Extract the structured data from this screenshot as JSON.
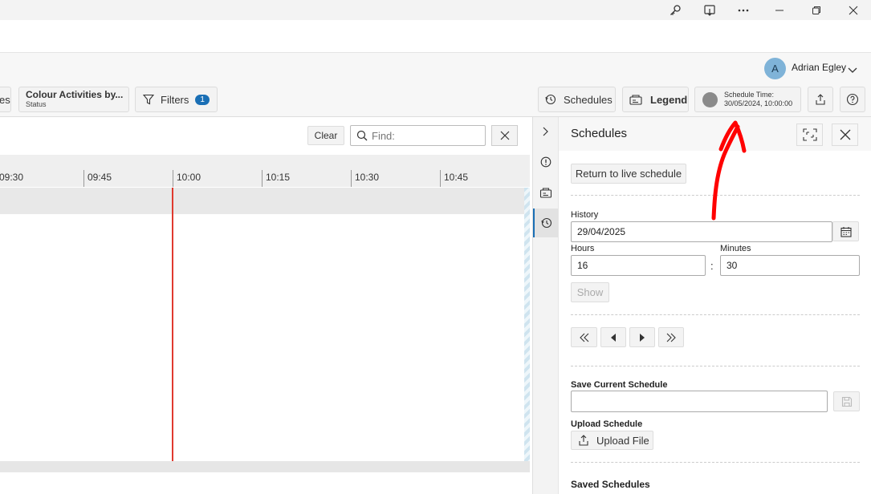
{
  "window": {
    "title_icons": [
      "key-icon",
      "reader-icon",
      "more-icon",
      "minimize-icon",
      "restore-icon",
      "close-icon"
    ]
  },
  "user": {
    "initial": "A",
    "name": "Adrian Egley"
  },
  "toolbar": {
    "truncated_left": "es",
    "colour_title": "Colour Activities by...",
    "colour_sub": "Status",
    "filters_label": "Filters",
    "filters_count": "1",
    "schedules_label": "Schedules",
    "legend_label": "Legend",
    "schedule_time_title": "Schedule Time:",
    "schedule_time_value": "30/05/2024, 10:00:00"
  },
  "find": {
    "clear_label": "Clear",
    "placeholder": "Find:"
  },
  "timeline": {
    "ticks": [
      "09:30",
      "09:45",
      "10:00",
      "10:15",
      "10:30",
      "10:45"
    ]
  },
  "panel": {
    "title": "Schedules",
    "return_label": "Return to live schedule",
    "history_label": "History",
    "history_value": "29/04/2025",
    "hours_label": "Hours",
    "hours_value": "16",
    "minutes_label": "Minutes",
    "minutes_value": "30",
    "colon": ":",
    "show_label": "Show",
    "save_label": "Save Current Schedule",
    "save_value": "",
    "upload_label": "Upload Schedule",
    "upload_button": "Upload File",
    "saved_label": "Saved Schedules"
  },
  "colors": {
    "accent": "#1a6fb5",
    "now_line": "#e03a2f",
    "annotation": "#ff0000",
    "avatar": "#7fb3d8"
  }
}
